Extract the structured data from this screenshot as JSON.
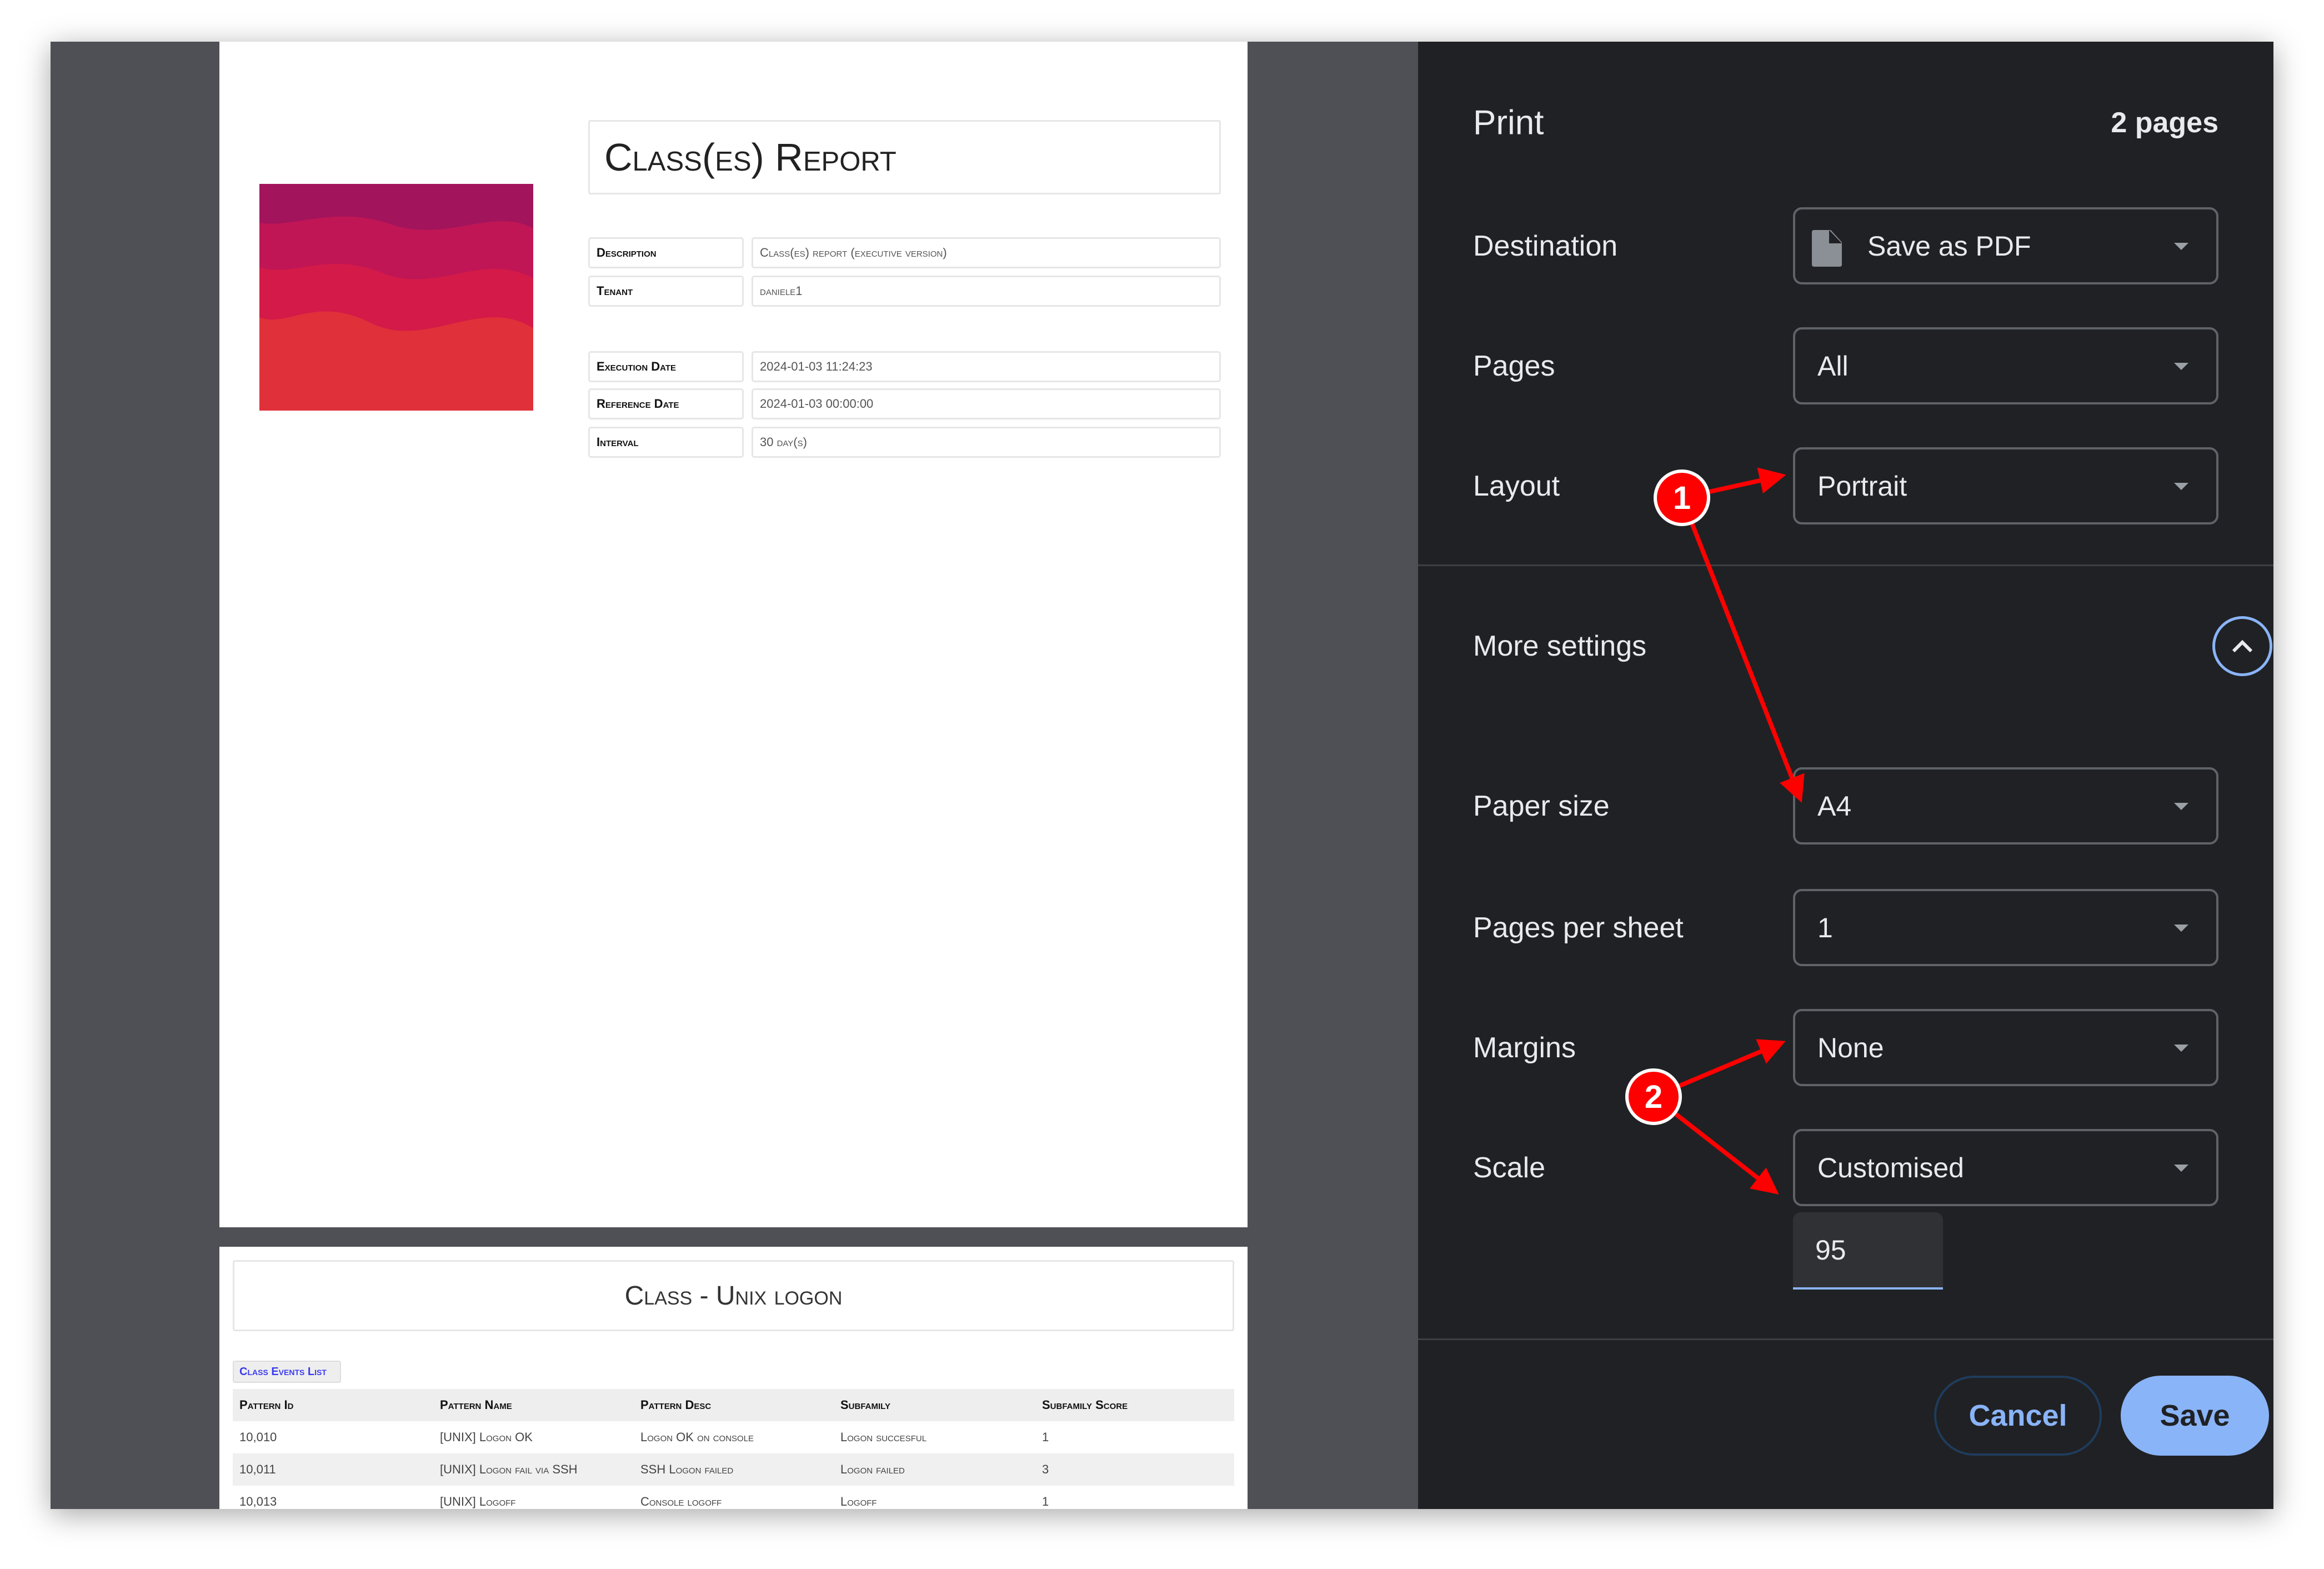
{
  "preview": {
    "page1": {
      "title": "Class(es) Report",
      "fields": [
        {
          "label": "Description",
          "value": "Class(es) report (executive version)"
        },
        {
          "label": "Tenant",
          "value": "daniele1"
        },
        {
          "label": "Execution Date",
          "value": "2024-01-03 11:24:23"
        },
        {
          "label": "Reference Date",
          "value": "2024-01-03 00:00:00"
        },
        {
          "label": "Interval",
          "value": "30 day(s)"
        }
      ]
    },
    "page2": {
      "title": "Class - Unix logon",
      "badge": "Class Events List",
      "columns": [
        "Pattern Id",
        "Pattern Name",
        "Pattern Desc",
        "Subfamily",
        "Subfamily Score"
      ],
      "rows": [
        [
          "10,010",
          "[UNIX] Logon OK",
          "Logon OK on console",
          "Logon succesful",
          "1"
        ],
        [
          "10,011",
          "[UNIX] Logon fail via SSH",
          "SSH Logon failed",
          "Logon failed",
          "3"
        ],
        [
          "10,013",
          "[UNIX] Logoff",
          "Console logoff",
          "Logoff",
          "1"
        ]
      ]
    }
  },
  "print": {
    "title": "Print",
    "page_count": "2 pages",
    "destination": {
      "label": "Destination",
      "value": "Save as PDF",
      "icon": "file-icon"
    },
    "pages": {
      "label": "Pages",
      "value": "All"
    },
    "layout": {
      "label": "Layout",
      "value": "Portrait"
    },
    "more_settings": {
      "label": "More settings",
      "expanded": true
    },
    "paper_size": {
      "label": "Paper size",
      "value": "A4"
    },
    "pages_per_sheet": {
      "label": "Pages per sheet",
      "value": "1"
    },
    "margins": {
      "label": "Margins",
      "value": "None"
    },
    "scale": {
      "label": "Scale",
      "value": "Customised",
      "custom_value": "95"
    },
    "cancel_label": "Cancel",
    "save_label": "Save"
  },
  "annotations": {
    "marker1": "1",
    "marker2": "2",
    "color": "#ff0000"
  },
  "colors": {
    "accent": "#8ab4f8",
    "panel_bg": "#202124",
    "preview_bg": "#4e5056"
  }
}
